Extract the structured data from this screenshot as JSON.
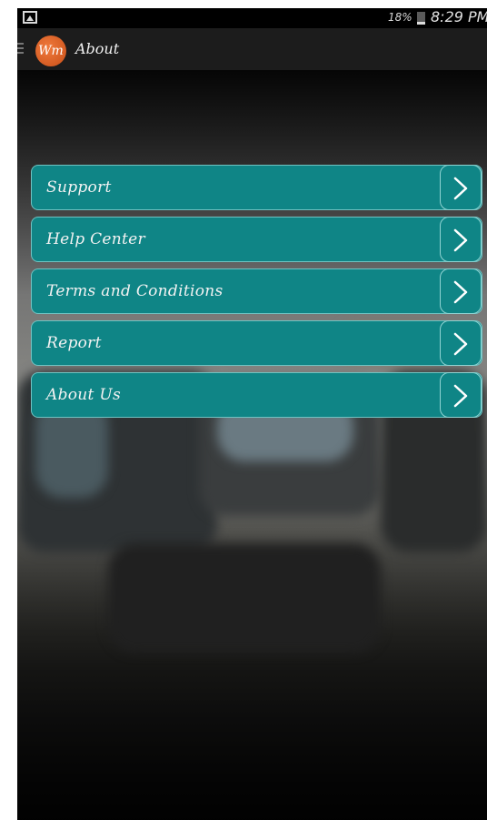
{
  "status_bar": {
    "battery_percent": "18%",
    "time": "8:29 PM"
  },
  "action_bar": {
    "logo_text": "Wm",
    "title": "About"
  },
  "menu": {
    "items": [
      {
        "label": "Support"
      },
      {
        "label": "Help Center"
      },
      {
        "label": "Terms and Conditions"
      },
      {
        "label": "Report"
      },
      {
        "label": "About Us"
      }
    ]
  },
  "colors": {
    "item_background": "#0f8586",
    "item_border": "#6fc3c2",
    "logo": "#e0642a"
  },
  "icons": {
    "status_left": "gallery-icon",
    "status_battery": "battery-icon",
    "nav": "menu-icon",
    "item_arrow": "chevron-right-icon"
  }
}
